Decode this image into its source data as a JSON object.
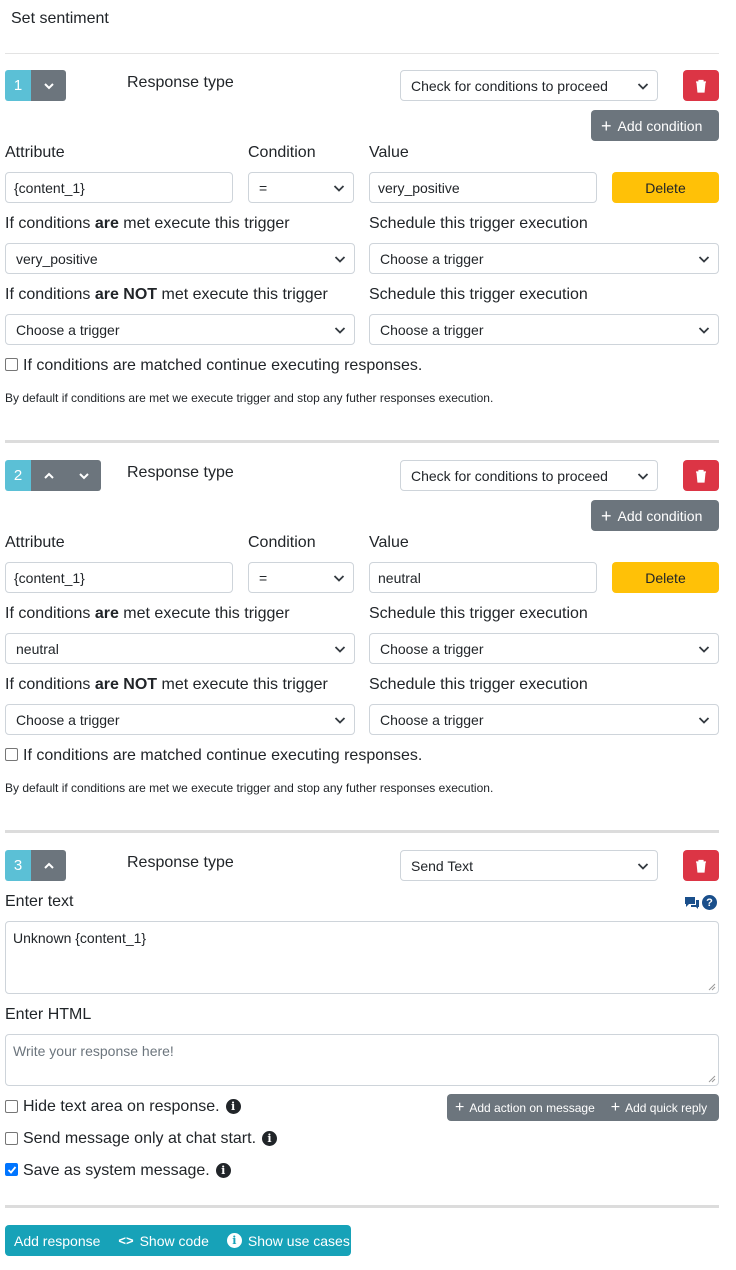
{
  "title": "Set sentiment",
  "labels": {
    "response_type": "Response type",
    "attribute": "Attribute",
    "condition": "Condition",
    "value": "Value",
    "met_prefix": "If conditions ",
    "met_bold": "are",
    "met_suffix": " met execute this trigger",
    "not_met_bold": "are NOT",
    "schedule": "Schedule this trigger execution",
    "continue": "If conditions are matched continue executing responses.",
    "note": "By default if conditions are met we execute trigger and stop any futher responses execution.",
    "add_condition": "Add condition",
    "delete": "Delete",
    "enter_text": "Enter text",
    "enter_html": "Enter HTML"
  },
  "responses": [
    {
      "number": "1",
      "response_type": "Check for conditions to proceed",
      "attribute": "{content_1}",
      "condition": "=",
      "value": "very_positive",
      "met_trigger": "very_positive",
      "met_schedule": "Choose a trigger",
      "not_met_trigger": "Choose a trigger",
      "not_met_schedule": "Choose a trigger",
      "continue_checked": false
    },
    {
      "number": "2",
      "response_type": "Check for conditions to proceed",
      "attribute": "{content_1}",
      "condition": "=",
      "value": "neutral",
      "met_trigger": "neutral",
      "met_schedule": "Choose a trigger",
      "not_met_trigger": "Choose a trigger",
      "not_met_schedule": "Choose a trigger",
      "continue_checked": false
    },
    {
      "number": "3",
      "response_type": "Send Text",
      "text_value": "Unknown {content_1}",
      "html_placeholder": "Write your response here!"
    }
  ],
  "options": {
    "hide_text_area": "Hide text area on response.",
    "hide_text_area_checked": false,
    "send_at_start": "Send message only at chat start.",
    "send_at_start_checked": false,
    "save_as_system": "Save as system message.",
    "save_as_system_checked": true
  },
  "actions": {
    "add_action_on_message": "Add action on message",
    "add_quick_reply": "Add quick reply"
  },
  "footer": {
    "add_response": "Add response",
    "show_code": "Show code",
    "show_use_cases": "Show use cases"
  },
  "colors": {
    "number_badge": "#5bc0d6",
    "secondary": "#6c757d",
    "danger": "#dc3545",
    "warning": "#ffc107",
    "info": "#17a2b8",
    "help_icon": "#1a4f8b"
  }
}
